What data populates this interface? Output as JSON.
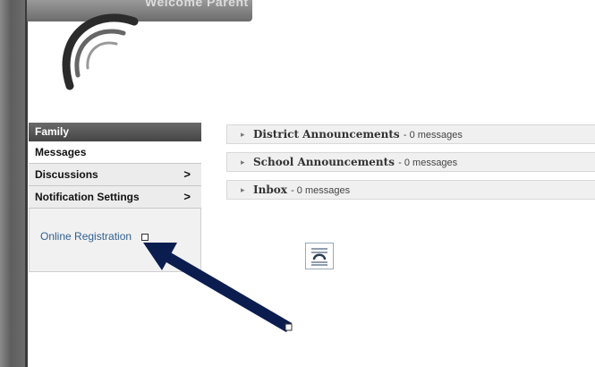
{
  "header": {
    "banner_text": "Welcome Parent"
  },
  "sidebar": {
    "section_title": "Family",
    "items": [
      {
        "label": "Messages",
        "chevron": ""
      },
      {
        "label": "Discussions",
        "chevron": ">"
      },
      {
        "label": "Notification Settings",
        "chevron": ">"
      }
    ],
    "panel": {
      "link": "Online Registration"
    }
  },
  "announcements": [
    {
      "title": "District Announcements",
      "count": "- 0 messages"
    },
    {
      "title": "School Announcements",
      "count": "- 0 messages"
    },
    {
      "title": "Inbox",
      "count": "- 0 messages"
    }
  ],
  "icons": {
    "logo": "swoosh-logo-icon",
    "document": "document-icon",
    "pointer": "pointer-arrow-icon",
    "expand": "caret-right-icon"
  },
  "colors": {
    "sidebar_header": "#454545",
    "link": "#2f5f8f",
    "pointer_arrow": "#0b1d4f"
  }
}
